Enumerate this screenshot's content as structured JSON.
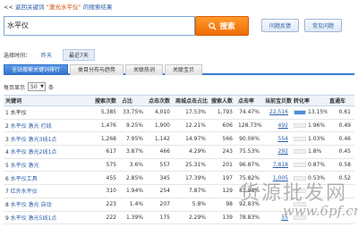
{
  "nav": {
    "back_prefix": "<< ",
    "back_link": "返回关键词",
    "keyword_quoted": "“激光水平仪”",
    "suffix": "的搜索结果"
  },
  "search": {
    "value": "水平仪",
    "button_label": "搜索",
    "feedback_label": "问题反馈",
    "faq_label": "常见问题"
  },
  "time": {
    "label": "选择时间：",
    "options": [
      "昨天",
      "最近7天"
    ],
    "active": "最近7天"
  },
  "tabs": [
    "全站搜索关键词排行",
    "类目分布与趋势",
    "关联热词",
    "关联宝贝"
  ],
  "paging": {
    "prefix": "每页显示",
    "value": "50",
    "suffix": "条"
  },
  "table": {
    "headers": [
      "关键词",
      "搜索次数",
      "占比",
      "点击次数",
      "商城点击占比",
      "搜索人数",
      "点击率",
      "当前宝贝数",
      "转化率",
      "直通车"
    ],
    "rows": [
      {
        "rank": "1",
        "keyword": "水平仪",
        "link": false,
        "searches": "5,385",
        "share": "33.75%",
        "clicks": "4,010",
        "mall": "17.53%",
        "users": "1,793",
        "ctr": "74.47%",
        "items": "22,516",
        "conv": "13.15%",
        "ztc": "0.61",
        "bar": 1.0
      },
      {
        "rank": "2",
        "keyword": "水平仪 激光 打线",
        "link": true,
        "searches": "1,476",
        "share": "9.25%",
        "clicks": "1,900",
        "mall": "12.21%",
        "users": "606",
        "ctr": "128.73%",
        "items": "492",
        "conv": "1.96%",
        "ztc": "0.49",
        "bar": 0.0
      },
      {
        "rank": "3",
        "keyword": "水平仪 激光3线1点",
        "link": true,
        "searches": "1,268",
        "share": "7.95%",
        "clicks": "1,142",
        "mall": "14.97%",
        "users": "566",
        "ctr": "90.06%",
        "items": "554",
        "conv": "1.03%",
        "ztc": "0.46",
        "bar": 0.0
      },
      {
        "rank": "4",
        "keyword": "水平仪 激光2线1点",
        "link": true,
        "searches": "617",
        "share": "3.87%",
        "clicks": "466",
        "mall": "4.29%",
        "users": "243",
        "ctr": "75.53%",
        "items": "292",
        "conv": "1.8%",
        "ztc": "0.45",
        "bar": 0.0
      },
      {
        "rank": "5",
        "keyword": "水平仪 激光",
        "link": true,
        "searches": "575",
        "share": "3.6%",
        "clicks": "557",
        "mall": "25.31%",
        "users": "201",
        "ctr": "96.87%",
        "items": "7,818",
        "conv": "0.87%",
        "ztc": "0.58",
        "bar": 0.0
      },
      {
        "rank": "6",
        "keyword": "水平仪工具",
        "link": true,
        "searches": "455",
        "share": "2.85%",
        "clicks": "345",
        "mall": "17.39%",
        "users": "197",
        "ctr": "75.82%",
        "items": "1,005",
        "conv": "0.53%",
        "ztc": "0.52",
        "bar": 0.0
      },
      {
        "rank": "7",
        "keyword": "红外水平仪",
        "link": true,
        "searches": "310",
        "share": "1.94%",
        "clicks": "254",
        "mall": "7.87%",
        "users": "129",
        "ctr": "81.94%",
        "items": "",
        "conv": "",
        "ztc": "",
        "bar": 0.0
      },
      {
        "rank": "8",
        "keyword": "水平仪 激光 自动",
        "link": true,
        "searches": "223",
        "share": "1.4%",
        "clicks": "207",
        "mall": "5.8%",
        "users": "98",
        "ctr": "92.83%",
        "items": "",
        "conv": "",
        "ztc": "",
        "bar": 0.0
      },
      {
        "rank": "9",
        "keyword": "水平仪 激光5线1点",
        "link": true,
        "searches": "222",
        "share": "1.39%",
        "clicks": "175",
        "mall": "2.29%",
        "users": "139",
        "ctr": "78.83%",
        "items": "55",
        "conv": "",
        "ztc": "",
        "bar": 0.0
      }
    ]
  },
  "watermark": {
    "text": "货源批发网",
    "url": "www.6pf.cn"
  },
  "colors": {
    "accent": "#f07800",
    "link": "#2a5ca8",
    "tab_active": "#3b7ad3"
  }
}
